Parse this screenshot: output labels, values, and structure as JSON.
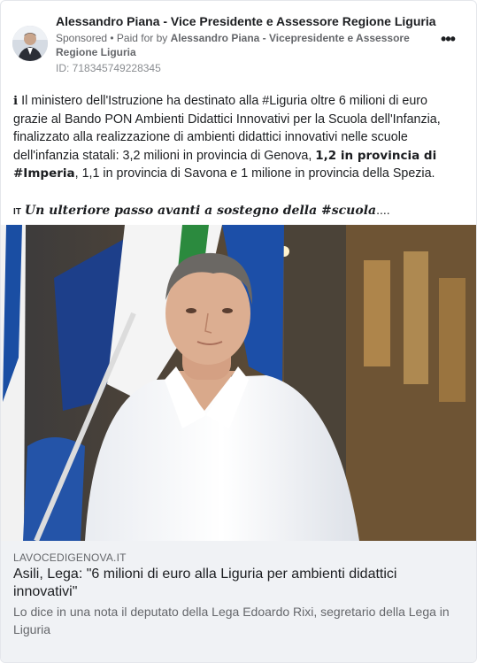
{
  "ad": {
    "advertiser_name": "Alessandro Piana - Vice Presidente e Assessore Regione Liguria",
    "sponsored_label": "Sponsored",
    "paid_prefix": " • Paid for by ",
    "paid_by": "Alessandro Piana - Vicepresidente e Assessore Regione Liguria",
    "ad_id": "ID: 718345749228345",
    "more_icon": "more-options-icon"
  },
  "post": {
    "info_symbol": "ℹ",
    "text_part1": " Il ministero dell'Istruzione ha destinato alla #Liguria oltre 6 milioni di euro grazie al Bando PON Ambienti Didattici Innovativi per la Scuola dell'Infanzia, finalizzato alla realizzazione di ambienti didattici innovativi nelle scuole dell'infanzia statali: 3,2 milioni in provincia di Genova, ",
    "text_bold": "1,2 in provincia di #Imperia",
    "text_part2": ", 1,1 in provincia di Savona e 1 milione in provincia della Spezia.",
    "tag_flag": "IT",
    "tag_text": "Un ulteriore passo avanti a sostegno della #scuola",
    "tag_ellipsis": "...."
  },
  "link_preview": {
    "domain": "LAVOCEDIGENOVA.IT",
    "title": "Asili, Lega: \"6 milioni di euro alla Liguria per ambienti didattici innovativi\"",
    "description": "Lo dice in una nota il deputato della Lega Edoardo Rixi, segretario della Lega in Liguria"
  }
}
